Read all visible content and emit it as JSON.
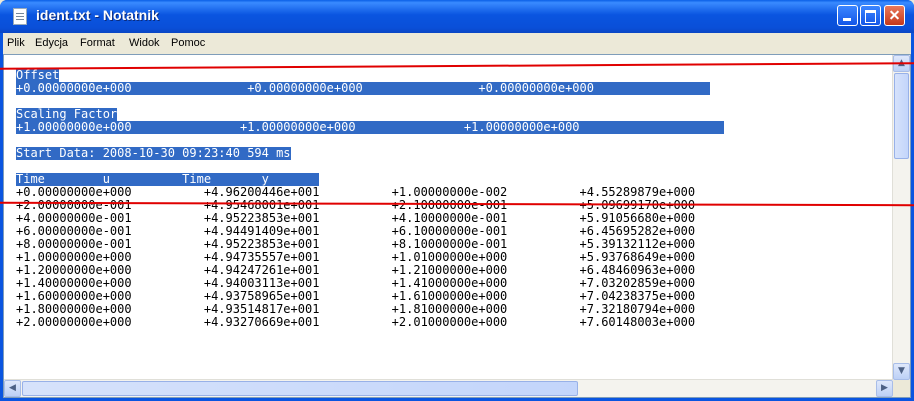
{
  "window": {
    "title": "ident.txt - Notatnik"
  },
  "menu": [
    "Plik",
    "Edycja",
    "Format",
    "Widok",
    "Pomoc"
  ],
  "lines": [
    {
      "text": "Offset",
      "selected": true
    },
    {
      "text": "+0.00000000e+000                +0.00000000e+000                +0.00000000e+000                ",
      "selected": true
    },
    {
      "text": "",
      "selected": false
    },
    {
      "text": "Scaling Factor",
      "selected": true
    },
    {
      "text": "+1.00000000e+000               +1.00000000e+000               +1.00000000e+000                    ",
      "selected": true
    },
    {
      "text": "",
      "selected": false
    },
    {
      "text": "Start Data: 2008-10-30 09:23:40 594 ms",
      "selected": true
    },
    {
      "text": "",
      "selected": false
    },
    {
      "text": "Time        u          Time       y       ",
      "selected": true
    },
    {
      "text": "+0.00000000e+000          +4.96200446e+001          +1.00000000e-002          +4.55289879e+000",
      "selected": false
    },
    {
      "text": "+2.00000000e-001          +4.95468001e+001          +2.10000000e-001          +5.09699170e+000",
      "selected": false
    },
    {
      "text": "+4.00000000e-001          +4.95223853e+001          +4.10000000e-001          +5.91056680e+000",
      "selected": false
    },
    {
      "text": "+6.00000000e-001          +4.94491409e+001          +6.10000000e-001          +6.45695282e+000",
      "selected": false
    },
    {
      "text": "+8.00000000e-001          +4.95223853e+001          +8.10000000e-001          +5.39132112e+000",
      "selected": false
    },
    {
      "text": "+1.00000000e+000          +4.94735557e+001          +1.01000000e+000          +5.93768649e+000",
      "selected": false
    },
    {
      "text": "+1.20000000e+000          +4.94247261e+001          +1.21000000e+000          +6.48460963e+000",
      "selected": false
    },
    {
      "text": "+1.40000000e+000          +4.94003113e+001          +1.41000000e+000          +7.03202859e+000",
      "selected": false
    },
    {
      "text": "+1.60000000e+000          +4.93758965e+001          +1.61000000e+000          +7.04238375e+000",
      "selected": false
    },
    {
      "text": "+1.80000000e+000          +4.93514817e+001          +1.81000000e+000          +7.32180794e+000",
      "selected": false
    },
    {
      "text": "+2.00000000e+000          +4.93270669e+001          +2.01000000e+000          +7.60148003e+000",
      "selected": false
    }
  ],
  "colors": {
    "selection": "#316ac5",
    "titlebar": "#0a55e0",
    "annotation_line": "#e00000"
  }
}
